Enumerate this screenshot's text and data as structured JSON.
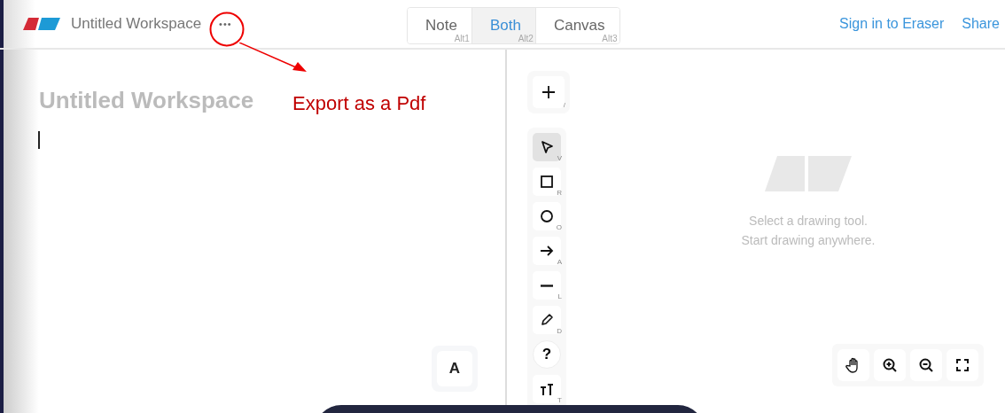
{
  "header": {
    "workspace_title": "Untitled Workspace",
    "more_button": "•••",
    "view_tabs": [
      {
        "label": "Note",
        "shortcut": "Alt1",
        "selected": false
      },
      {
        "label": "Both",
        "shortcut": "Alt2",
        "selected": true
      },
      {
        "label": "Canvas",
        "shortcut": "Alt3",
        "selected": false
      }
    ],
    "links": [
      "Sign in to Eraser",
      "Share"
    ]
  },
  "annotation": {
    "text": "Export as a Pdf"
  },
  "note": {
    "title": "Untitled Workspace",
    "format_button": "A"
  },
  "canvas": {
    "add_shortcut": "/",
    "tools": [
      {
        "kind": "select",
        "shortcut": "V",
        "selected": true
      },
      {
        "kind": "rectangle",
        "shortcut": "R",
        "selected": false
      },
      {
        "kind": "ellipse",
        "shortcut": "O",
        "selected": false
      },
      {
        "kind": "arrow",
        "shortcut": "A",
        "selected": false
      },
      {
        "kind": "line",
        "shortcut": "L",
        "selected": false
      },
      {
        "kind": "pencil",
        "shortcut": "D",
        "selected": false
      },
      {
        "kind": "text",
        "shortcut": "T",
        "selected": false
      }
    ],
    "empty_hint": [
      "Select a drawing tool.",
      "Start drawing anywhere."
    ],
    "help_button": "?"
  }
}
